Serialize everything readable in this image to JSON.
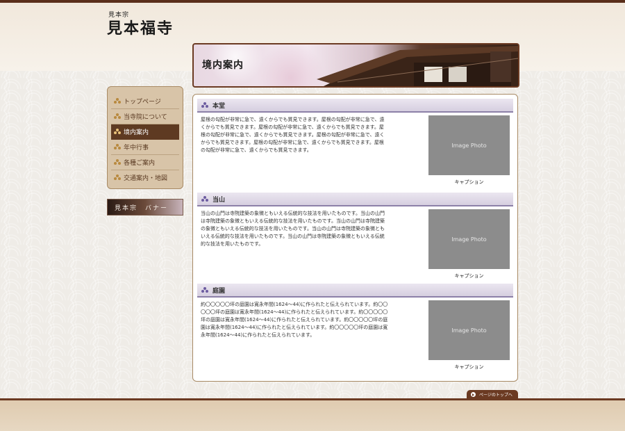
{
  "header": {
    "subtitle": "見本宗",
    "title": "見本福寺"
  },
  "hero": {
    "title": "境内案内"
  },
  "sidebar": {
    "items": [
      {
        "label": "トップページ",
        "active": false
      },
      {
        "label": "当寺院について",
        "active": false
      },
      {
        "label": "境内案内",
        "active": true
      },
      {
        "label": "年中行事",
        "active": false
      },
      {
        "label": "各種ご案内",
        "active": false
      },
      {
        "label": "交通案内・地図",
        "active": false
      }
    ],
    "banner_label": "見本宗　バナー"
  },
  "sections": [
    {
      "title": "本堂",
      "text": "屋根の勾配が非常に急で、遠くからでも質見できます。屋根の勾配が非常に急で、遠くからでも質見できます。屋根の勾配が非常に急で、遠くからでも質見できます。屋根の勾配が非常に急で、遠くからでも質見できます。屋根の勾配が非常に急で、遠くからでも質見できます。屋根の勾配が非常に急で、遠くからでも質見できます。屋根の勾配が非常に急で、遠くからでも質見できます。",
      "photo_label": "Image Photo",
      "caption": "キャプション"
    },
    {
      "title": "当山",
      "text": "当山の山門は寺院建築の象徴ともいえる伝統的な技法を用いたものです。当山の山門は寺院建築の象徴ともいえる伝統的な技法を用いたものです。当山の山門は寺院建築の象徴ともいえる伝統的な技法を用いたものです。当山の山門は寺院建築の象徴ともいえる伝統的な技法を用いたものです。当山の山門は寺院建築の象徴ともいえる伝統的な技法を用いたものです。",
      "photo_label": "Image Photo",
      "caption": "キャプション"
    },
    {
      "title": "庭園",
      "text": "約〇〇〇〇〇坪の庭園は寛永年間(1624〜44)に作られたと伝えられています。約〇〇〇〇〇坪の庭園は寛永年間(1624〜44)に作られたと伝えられています。約〇〇〇〇〇坪の庭園は寛永年間(1624〜44)に作られたと伝えられています。約〇〇〇〇〇坪の庭園は寛永年間(1624〜44)に作られたと伝えられています。約〇〇〇〇〇坪の庭園は寛永年間(1624〜44)に作られたと伝えられています。",
      "photo_label": "Image Photo",
      "caption": "キャプション"
    }
  ],
  "footer": {
    "page_top_label": "ページのトップへ"
  },
  "colors": {
    "brown": "#6b3a22",
    "sidebar_bg": "#d8c4a8",
    "section_accent": "#8c80a8"
  }
}
